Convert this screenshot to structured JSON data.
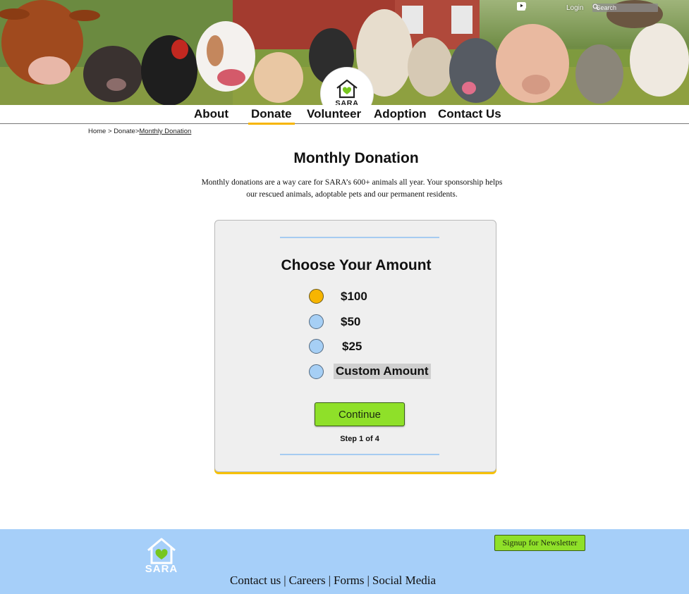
{
  "header": {
    "social_icons": [
      "facebook-icon",
      "instagram-icon",
      "tiktok-icon",
      "youtube-icon"
    ],
    "login_label": "Login",
    "search_placeholder": "Search",
    "logo_text": "SARA"
  },
  "nav": {
    "items": [
      {
        "label": "About"
      },
      {
        "label": "Donate",
        "active": true
      },
      {
        "label": "Volunteer"
      },
      {
        "label": "Adoption"
      },
      {
        "label": "Contact Us"
      }
    ]
  },
  "breadcrumb": {
    "home": "Home",
    "sep1": ">",
    "donate": "Donate",
    "sep2": ">",
    "current": "Monthly Donation"
  },
  "page": {
    "title": "Monthly Donation",
    "intro_line1": "Monthly donations are a way care for SARA’s 600+ animals all year. Your sponsorship helps",
    "intro_line2": "our rescued animals, adoptable pets and our permanent residents."
  },
  "card": {
    "title": "Choose Your Amount",
    "options": [
      {
        "label": "$100",
        "selected": true
      },
      {
        "label": "$50",
        "selected": false
      },
      {
        "label": "$25",
        "selected": false
      },
      {
        "label": "Custom Amount",
        "selected": false
      }
    ],
    "continue_label": "Continue",
    "step_text": "Step 1 of 4"
  },
  "footer": {
    "logo_text": "SARA",
    "newsletter_label": "Signup for Newsletter",
    "links": [
      "Contact us",
      "Careers",
      "Forms",
      "Social Media"
    ],
    "separator": "|"
  },
  "colors": {
    "accent_yellow": "#f7b500",
    "button_green": "#8fe029",
    "footer_blue": "#a6cff9",
    "radio_blue": "#a6cff5",
    "card_bg": "#efefef"
  }
}
